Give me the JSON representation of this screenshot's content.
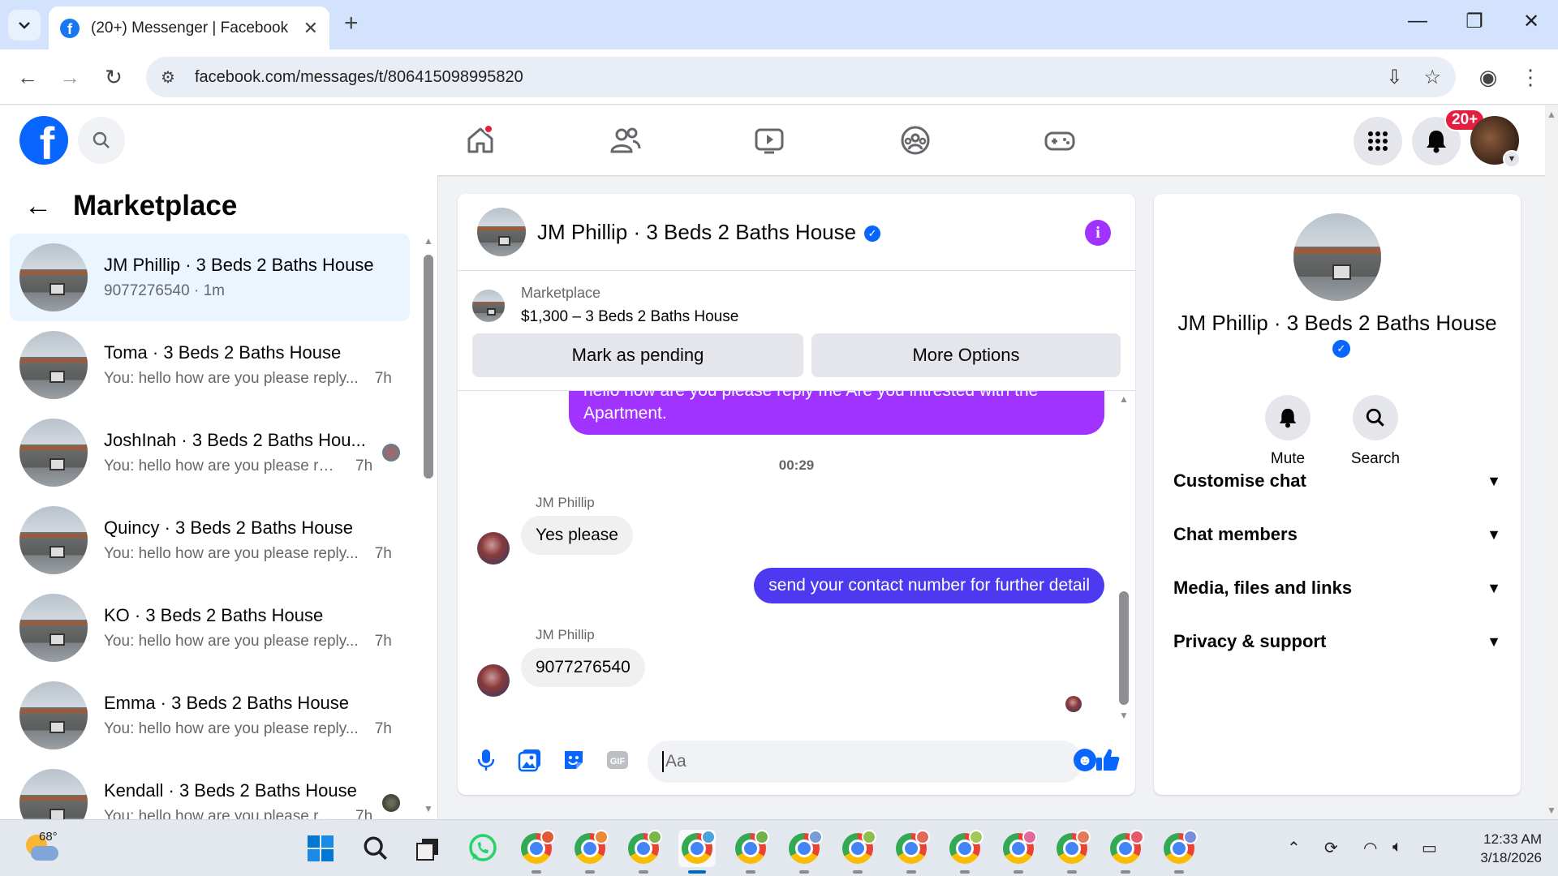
{
  "browser": {
    "tab_title": "(20+) Messenger | Facebook",
    "url": "facebook.com/messages/t/806415098995820"
  },
  "header": {
    "notification_badge": "20+"
  },
  "chat_list": {
    "title": "Marketplace",
    "items": [
      {
        "name": "JM Phillip · 3 Beds 2 Baths House",
        "preview": "9077276540",
        "time": "1m",
        "active": true
      },
      {
        "name": "Toma · 3 Beds 2 Baths House",
        "preview": "You: hello how are you please reply...",
        "time": "7h"
      },
      {
        "name": "JoshInah · 3 Beds 2 Baths Hou...",
        "preview": "You: hello how are you please re...",
        "time": "7h"
      },
      {
        "name": "Quincy · 3 Beds 2 Baths House",
        "preview": "You: hello how are you please reply...",
        "time": "7h"
      },
      {
        "name": "KO · 3 Beds 2 Baths House",
        "preview": "You: hello how are you please reply...",
        "time": "7h"
      },
      {
        "name": "Emma · 3 Beds 2 Baths House",
        "preview": "You: hello how are you please reply...",
        "time": "7h"
      },
      {
        "name": "Kendall · 3 Beds 2 Baths House",
        "preview": "You: hello how are you please re...",
        "time": "7h"
      }
    ]
  },
  "conversation": {
    "title": "JM Phillip · 3 Beds 2 Baths House",
    "listing": {
      "label": "Marketplace",
      "price_title": "$1,300 – 3 Beds 2 Baths House"
    },
    "buttons": {
      "mark_pending": "Mark as pending",
      "more_options": "More Options"
    },
    "messages": {
      "outgoing_partial_line1": "hello how are you please reply me Are you intrested  with the",
      "outgoing_partial_line2": "Apartment.",
      "timestamp": "00:29",
      "sender_name": "JM Phillip",
      "incoming_1": "Yes please",
      "outgoing_2": "send your contact number for further detail",
      "incoming_2": "9077276540"
    },
    "composer_placeholder": "Aa",
    "gif_label": "GIF"
  },
  "info_panel": {
    "name": "JM Phillip · 3 Beds 2 Baths House",
    "mute_label": "Mute",
    "search_label": "Search",
    "sections": [
      "Customise chat",
      "Chat members",
      "Media, files and links",
      "Privacy & support"
    ]
  },
  "taskbar": {
    "temperature": "68°",
    "time": "12:33 AM",
    "date": "3/18/2026",
    "chrome_profile_colors": [
      "#e05a3a",
      "#e8893c",
      "#7ab648",
      "#4aa3df",
      "#6fb24a",
      "#7a9cd6",
      "#8fbf4a",
      "#e36a5a",
      "#a3c85a",
      "#e06aa0",
      "#e37b5a",
      "#e35a6a",
      "#7a8ee0"
    ]
  }
}
